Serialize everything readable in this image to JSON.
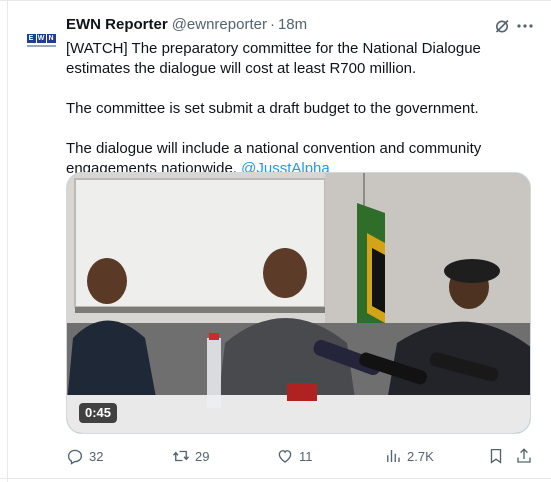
{
  "tweet": {
    "author_name": "EWN Reporter",
    "author_handle": "@ewnreporter",
    "separator": "·",
    "time": "18m",
    "avatar": {
      "logo_letters": [
        "E",
        "W",
        "N"
      ],
      "brand_color": "#1d3f8f",
      "icon": "ewn-logo-icon"
    },
    "text": {
      "p1": "[WATCH] The preparatory committee for the National Dialogue estimates the dialogue will cost at least R700 million.",
      "p2": "The committee is set submit a draft budget to the government.",
      "p3": "The dialogue will include a national convention and community engagements nationwide.",
      "mention": "@JusstAlpha"
    },
    "media": {
      "type": "video",
      "duration": "0:45"
    }
  },
  "actions": {
    "replies": "32",
    "retweets": "29",
    "likes": "11",
    "views": "2.7K",
    "icons": [
      "reply-icon",
      "retweet-icon",
      "like-icon",
      "views-icon",
      "bookmark-icon",
      "share-icon",
      "grok-icon",
      "more-icon"
    ]
  },
  "colors": {
    "text": "#0f1419",
    "muted": "#536471",
    "link": "#1d9bf0",
    "border": "#e7e9ea"
  }
}
